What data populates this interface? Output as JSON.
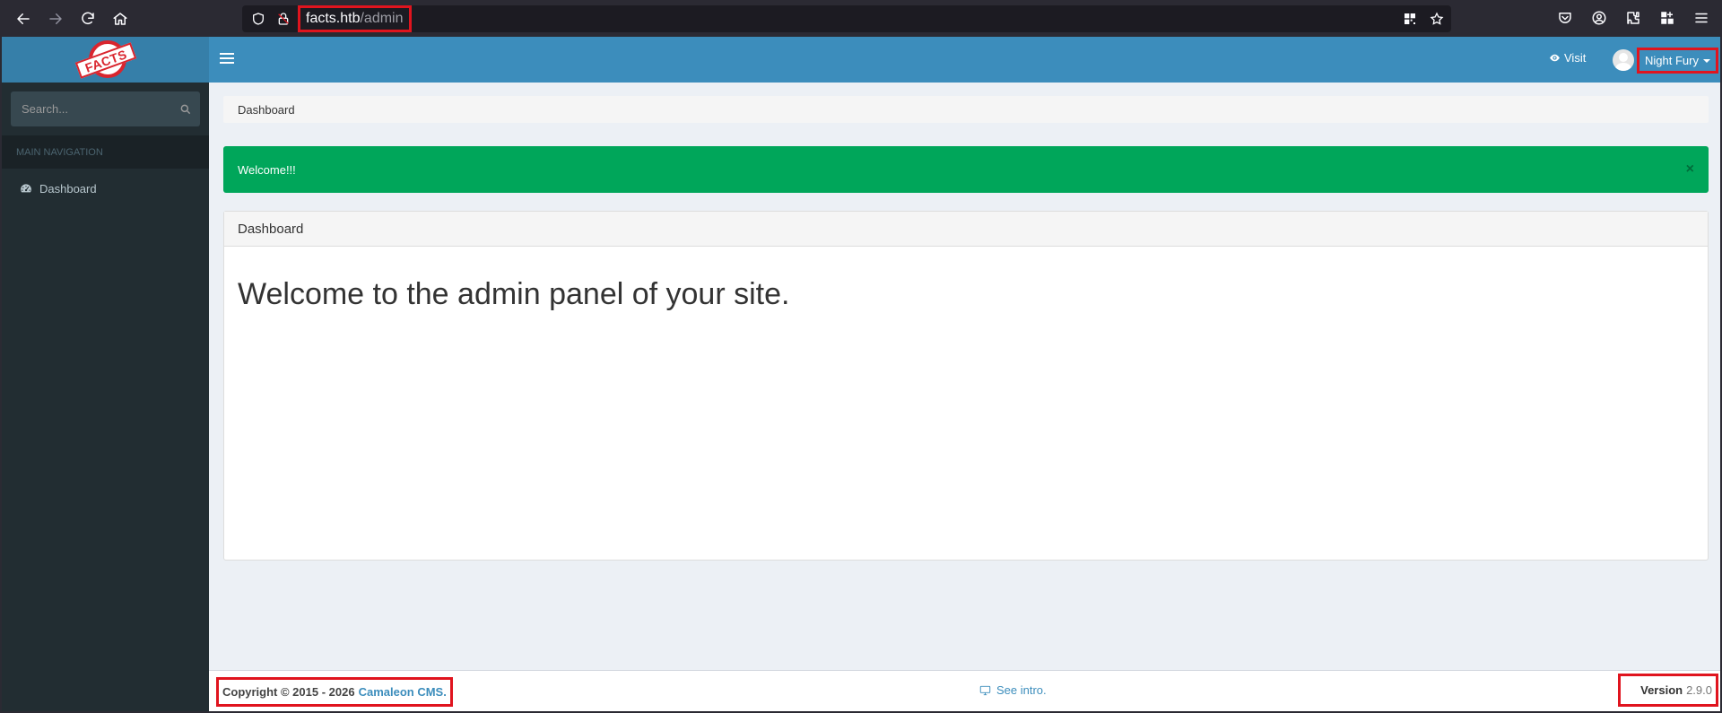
{
  "browser": {
    "url_host": "facts.htb",
    "url_path": "/admin"
  },
  "sidebar": {
    "logo_text": "FACTS",
    "search_placeholder": "Search...",
    "header": "MAIN NAVIGATION",
    "items": [
      {
        "label": "Dashboard",
        "icon": "dashboard-icon"
      }
    ]
  },
  "topbar": {
    "visit_label": "Visit",
    "user_name": "Night Fury"
  },
  "breadcrumb": "Dashboard",
  "alert": {
    "message": "Welcome!!!",
    "close": "×",
    "color": "#00a65a"
  },
  "panel": {
    "title": "Dashboard",
    "body": "Welcome to the admin panel of your site."
  },
  "footer": {
    "copyright": "Copyright © 2015 - 2026",
    "brand": "Camaleon CMS.",
    "intro": "See intro.",
    "version_label": "Version",
    "version": "2.9.0"
  },
  "colors": {
    "topbar": "#3c8dbc",
    "sidebar": "#222d32",
    "annotation_box": "#e0141e"
  }
}
